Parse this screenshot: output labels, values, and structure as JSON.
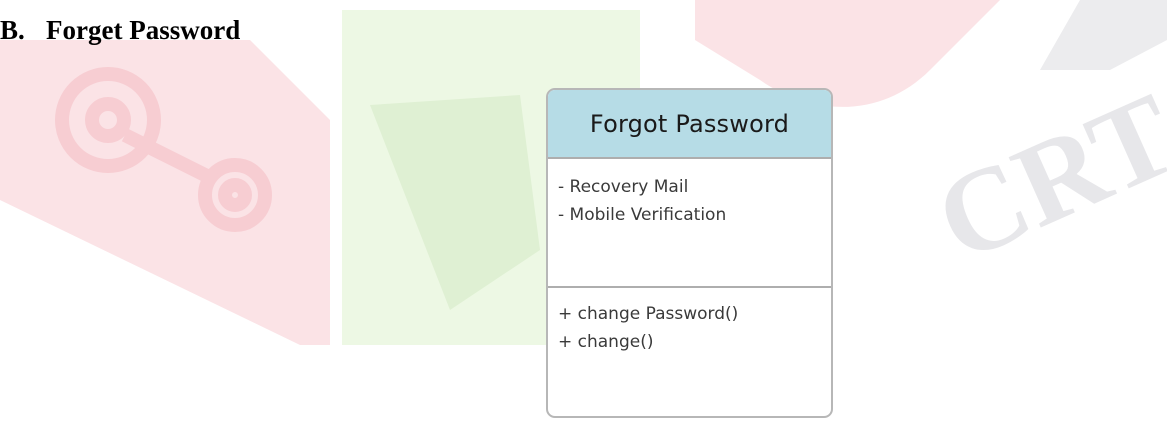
{
  "heading": {
    "label": "B.",
    "title": "Forget Password"
  },
  "class_box": {
    "name": "Forgot Password",
    "header_color": "#b6dce6",
    "attributes": [
      "- Recovery Mail",
      "- Mobile Verification"
    ],
    "methods": [
      "+ change Password()",
      "+ change()"
    ]
  },
  "watermark": {
    "text": "CRT",
    "colors": [
      "#fbe3e5",
      "#ebf7e1",
      "#e7e7ea"
    ]
  }
}
